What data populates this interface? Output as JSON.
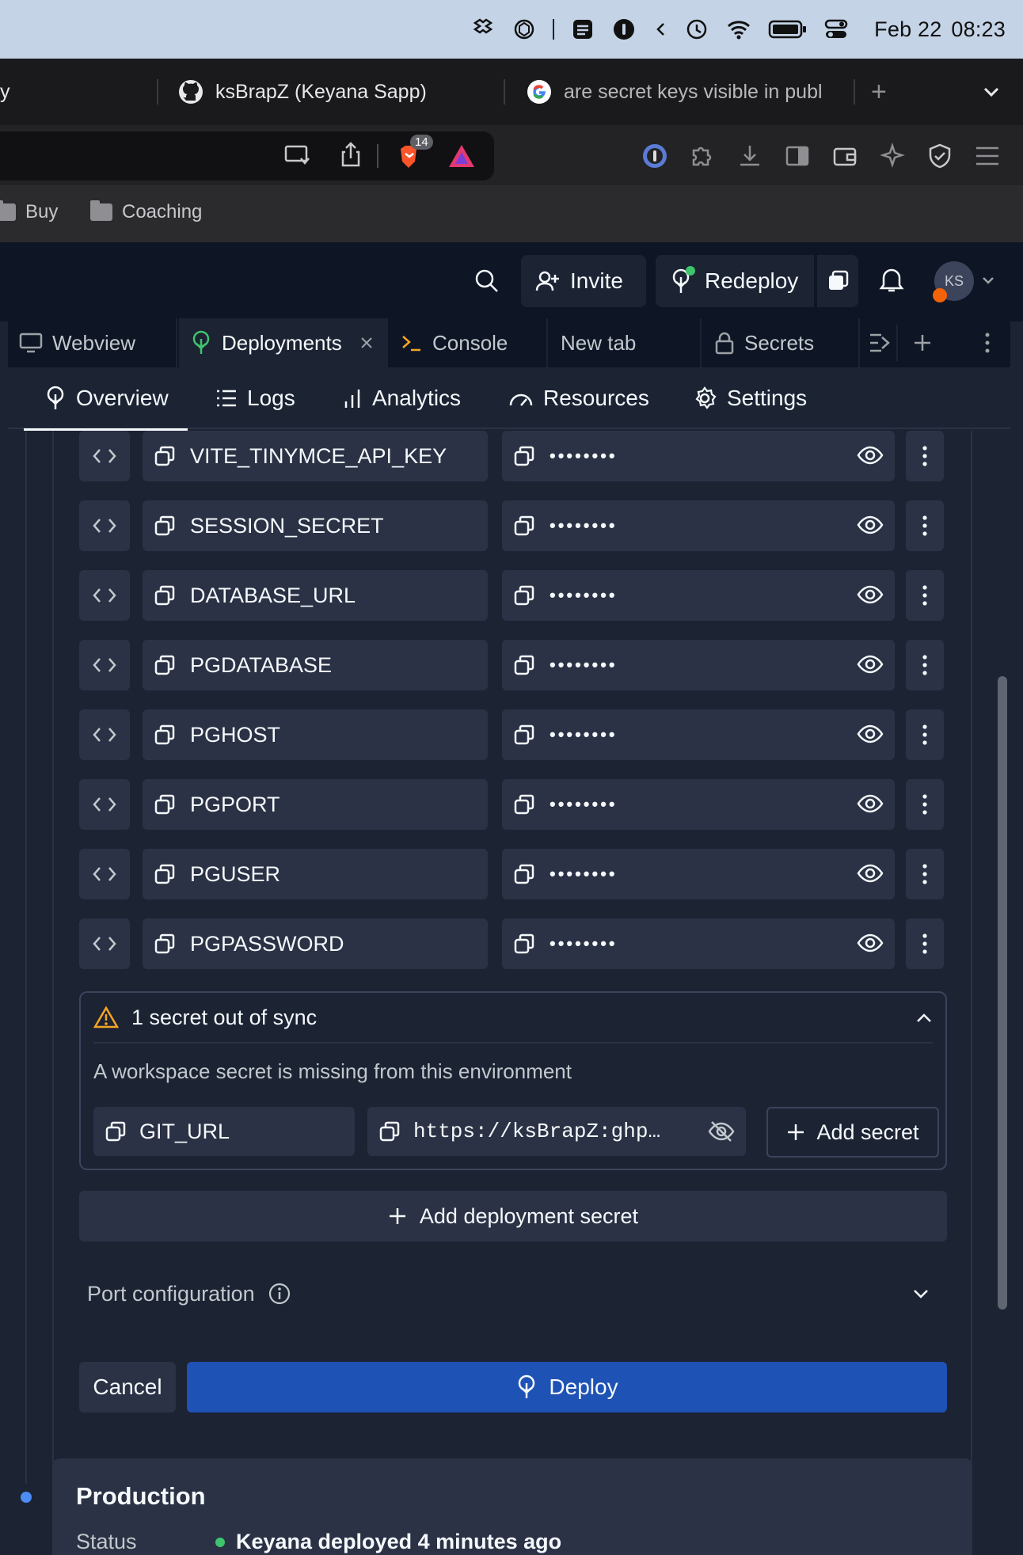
{
  "menubar": {
    "date": "Feb 22",
    "time": "08:23",
    "icons": [
      "dropbox-like-icon",
      "chatgpt-icon",
      "notes-icon",
      "1password-icon",
      "chevron-left-icon",
      "time-machine-icon",
      "wifi-icon",
      "battery-icon",
      "control-center-icon"
    ]
  },
  "browser": {
    "tabs": [
      {
        "label": "y"
      },
      {
        "label": "ksBrapZ (Keyana Sapp)",
        "icon": "github-icon"
      },
      {
        "label": "are secret keys visible in publ",
        "icon": "google-icon"
      }
    ],
    "new_tab_label": "+",
    "brave_badge": "14",
    "bookmarks": [
      "Buy",
      "Coaching"
    ]
  },
  "header": {
    "invite_label": "Invite",
    "redeploy_label": "Redeploy",
    "avatar_initials": "KS"
  },
  "pane_tabs": [
    {
      "label": "Webview"
    },
    {
      "label": "Deployments"
    },
    {
      "label": "Console"
    },
    {
      "label": "New tab"
    },
    {
      "label": "Secrets"
    }
  ],
  "sub_tabs": [
    {
      "label": "Overview"
    },
    {
      "label": "Logs"
    },
    {
      "label": "Analytics"
    },
    {
      "label": "Resources"
    },
    {
      "label": "Settings"
    }
  ],
  "secrets": [
    {
      "key": "VITE_TINYMCE_API_KEY",
      "value": "••••••••"
    },
    {
      "key": "SESSION_SECRET",
      "value": "••••••••"
    },
    {
      "key": "DATABASE_URL",
      "value": "••••••••"
    },
    {
      "key": "PGDATABASE",
      "value": "••••••••"
    },
    {
      "key": "PGHOST",
      "value": "••••••••"
    },
    {
      "key": "PGPORT",
      "value": "••••••••"
    },
    {
      "key": "PGUSER",
      "value": "••••••••"
    },
    {
      "key": "PGPASSWORD",
      "value": "••••••••"
    }
  ],
  "sync": {
    "title": "1 secret out of sync",
    "description": "A workspace secret is missing from this environment",
    "key": "GIT_URL",
    "value": "https://ksBrapZ:ghp…",
    "add_label": "Add secret"
  },
  "add_deployment_secret_label": "Add deployment secret",
  "port_configuration_label": "Port configuration",
  "cancel_label": "Cancel",
  "deploy_label": "Deploy",
  "production": {
    "title": "Production",
    "status_label": "Status",
    "status_text": "Keyana deployed 4 minutes ago"
  },
  "colors": {
    "accent_blue": "#1e52b4",
    "background": "#1c2333",
    "surface": "#2b3245",
    "warning": "#f5a524",
    "success": "#3ec46d"
  }
}
